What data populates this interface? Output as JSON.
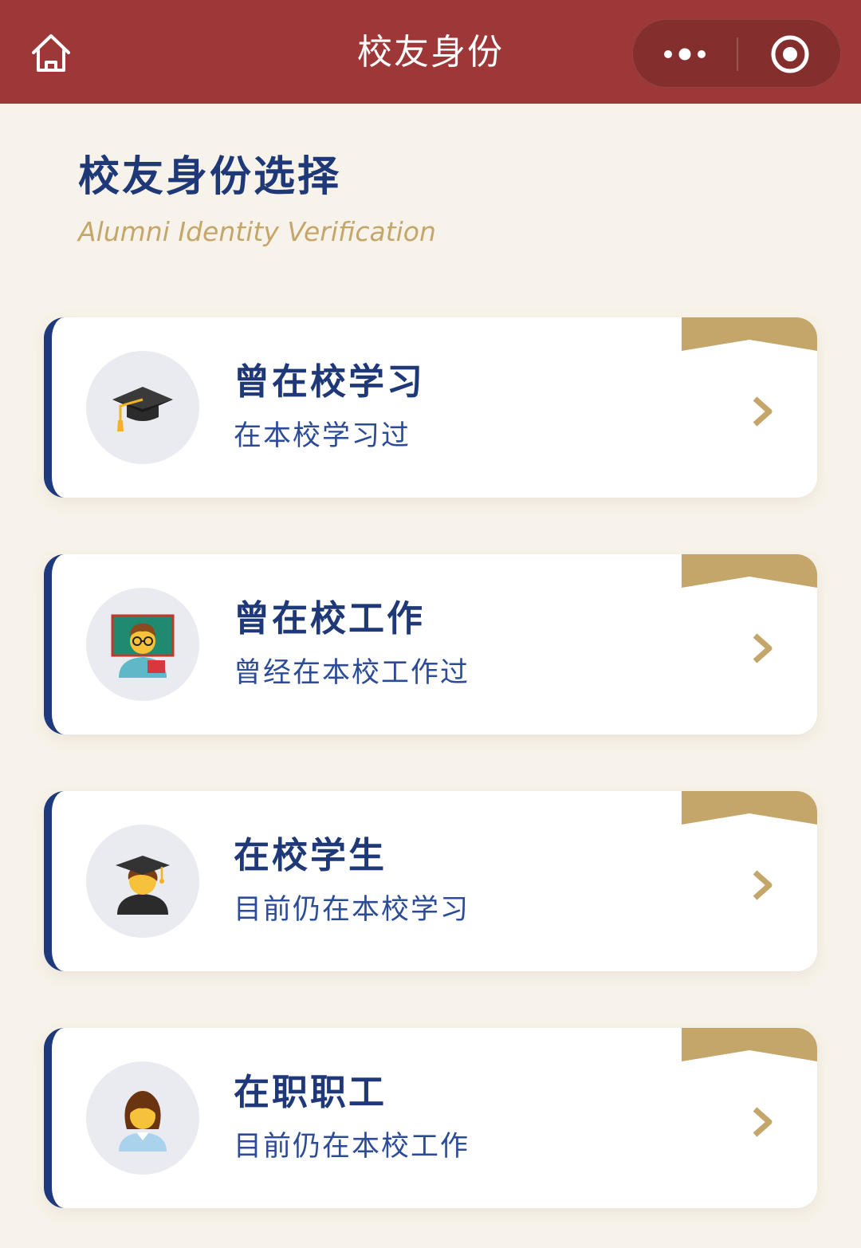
{
  "navbar": {
    "title": "校友身份",
    "bg_color": "#9e3737",
    "home_icon": "home-icon",
    "more_icon": "more-dots-icon",
    "close_icon": "target-circle-icon"
  },
  "header": {
    "title": "校友身份选择",
    "subtitle": "Alumni Identity Verification"
  },
  "colors": {
    "primary_navy": "#1f3878",
    "accent_gold": "#c5a66a",
    "page_bg": "#f8f3ea",
    "card_bg": "#ffffff"
  },
  "options": [
    {
      "title": "曾在校学习",
      "description": "在本校学习过",
      "icon": "graduation-cap-icon"
    },
    {
      "title": "曾在校工作",
      "description": "曾经在本校工作过",
      "icon": "teacher-icon"
    },
    {
      "title": "在校学生",
      "description": "目前仍在本校学习",
      "icon": "student-graduate-icon"
    },
    {
      "title": "在职职工",
      "description": "目前仍在本校工作",
      "icon": "office-worker-icon"
    }
  ]
}
